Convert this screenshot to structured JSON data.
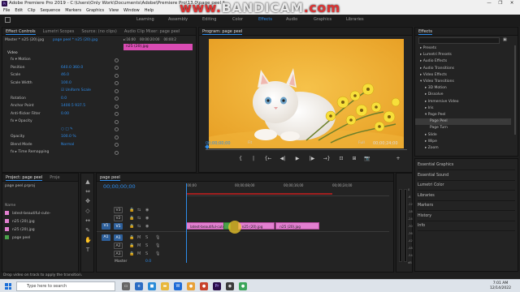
{
  "window": {
    "title": "Adobe Premiere Pro 2019 - C:\\Users\\Only Work\\Documents\\Adobe\\Premiere Pro\\13.0\\page peel *",
    "controls": [
      "—",
      "❐",
      "✕"
    ]
  },
  "watermark": {
    "prefix": "www.",
    "brand": "BANDICAM",
    "suffix": ".com"
  },
  "menu": [
    "File",
    "Edit",
    "Clip",
    "Sequence",
    "Markers",
    "Graphics",
    "View",
    "Window",
    "Help"
  ],
  "workspaces": [
    "Learning",
    "Assembly",
    "Editing",
    "Color",
    "Effects",
    "Audio",
    "Graphics",
    "Libraries"
  ],
  "workspace_active": "Effects",
  "effect_controls": {
    "tabs": [
      "Effect Controls",
      "Lumetri Scopes",
      "Source: (no clips)",
      "Audio Clip Mixer: page peel"
    ],
    "master": "Master * n25 (20).jpg",
    "sequence": "page peel * n25 (20).jpg",
    "ruler": [
      "▸:16:00",
      "00:00:20:00",
      "00:00:2"
    ],
    "mini_clip": "n25 (20).jpg",
    "section_video": "Video",
    "rows": [
      {
        "label": "fx ▾ Motion",
        "value": ""
      },
      {
        "label": "Position",
        "value": "640.0   360.0"
      },
      {
        "label": "Scale",
        "value": "46.0"
      },
      {
        "label": "Scale Width",
        "value": "100.0"
      },
      {
        "label": "",
        "value": "☑ Uniform Scale"
      },
      {
        "label": "Rotation",
        "value": "0.0"
      },
      {
        "label": "Anchor Point",
        "value": "1400.5   937.5"
      },
      {
        "label": "Anti-flicker Filter",
        "value": "0.00"
      },
      {
        "label": "fx ▾ Opacity",
        "value": ""
      },
      {
        "label": "",
        "value": "○ □ ✎"
      },
      {
        "label": "Opacity",
        "value": "100.0 %"
      },
      {
        "label": "Blend Mode",
        "value": "Normal"
      },
      {
        "label": "fx ▸ Time Remapping",
        "value": ""
      }
    ]
  },
  "program_monitor": {
    "title": "Program: page peel",
    "timecode": "00;00;00;00",
    "fit": "Fit",
    "resolution": "Full",
    "duration": "00;00;24;00",
    "controls": [
      "{",
      "|",
      "{←",
      "◀|",
      "▶",
      "|▶",
      "→}",
      "⊡",
      "⊞",
      "📷",
      "+"
    ]
  },
  "effects": {
    "title": "Effects",
    "items": [
      {
        "label": "▸ Presets",
        "indent": 1
      },
      {
        "label": "▸ Lumetri Presets",
        "indent": 1
      },
      {
        "label": "▸ Audio Effects",
        "indent": 1
      },
      {
        "label": "▸ Audio Transitions",
        "indent": 1
      },
      {
        "label": "▸ Video Effects",
        "indent": 1
      },
      {
        "label": "▾ Video Transitions",
        "indent": 1
      },
      {
        "label": "▸ 3D Motion",
        "indent": 2
      },
      {
        "label": "▸ Dissolve",
        "indent": 2
      },
      {
        "label": "▸ Immersive Video",
        "indent": 2
      },
      {
        "label": "▸ Iris",
        "indent": 2
      },
      {
        "label": "▾ Page Peel",
        "indent": 2
      },
      {
        "label": "Page Peel",
        "indent": 3
      },
      {
        "label": "Page Turn",
        "indent": 3
      },
      {
        "label": "▸ Slide",
        "indent": 2
      },
      {
        "label": "▸ Wipe",
        "indent": 2
      },
      {
        "label": "▸ Zoom",
        "indent": 2
      }
    ],
    "selected": 11
  },
  "side_panels": [
    "Essential Graphics",
    "Essential Sound",
    "Lumetri Color",
    "Libraries",
    "Markers",
    "History",
    "Info"
  ],
  "project": {
    "tabs": [
      "Project: page peel",
      "Proje"
    ],
    "file": "page peel.prproj",
    "column": "Name",
    "items": [
      {
        "name": "latest-beautiful-cute-",
        "color": "#e27fd0"
      },
      {
        "name": "n25 (20).jpg",
        "color": "#e27fd0"
      },
      {
        "name": "n25 (20).jpg",
        "color": "#e27fd0"
      },
      {
        "name": "page peel",
        "color": "#4aa14a"
      }
    ]
  },
  "tools": [
    "▲",
    "⇔",
    "✥",
    "◇",
    "↔",
    "✎",
    "✋",
    "T"
  ],
  "timeline": {
    "title": "page peel",
    "timecode": "00;00;00;00",
    "ruler": [
      ":00;00",
      "00;00;08;00",
      "00;00;16;00",
      "00;00;24;00"
    ],
    "video_tracks": [
      "V3",
      "V2",
      "V1"
    ],
    "audio_tracks": [
      "A1",
      "A2",
      "A3"
    ],
    "source_v": "V1",
    "source_a": "A1",
    "master": "Master",
    "master_value": "0.0",
    "clips": [
      {
        "name": "latest-beautiful-cute-",
        "start": 0,
        "end": 7.2
      },
      {
        "name": "n25 (20).jpg",
        "start": 8.5,
        "end": 14.7
      },
      {
        "name": "n25 (20).jpg",
        "start": 14.7,
        "end": 22
      }
    ]
  },
  "meter_scale": [
    "0",
    "-6",
    "-12",
    "-18",
    "-24",
    "-30",
    "-36",
    "-42",
    "-48",
    "-54",
    "dB"
  ],
  "status": "Drop video on track to apply the transition.",
  "taskbar": {
    "search": "Type here to search",
    "time": "7:01 AM",
    "date": "12/14/2022"
  }
}
